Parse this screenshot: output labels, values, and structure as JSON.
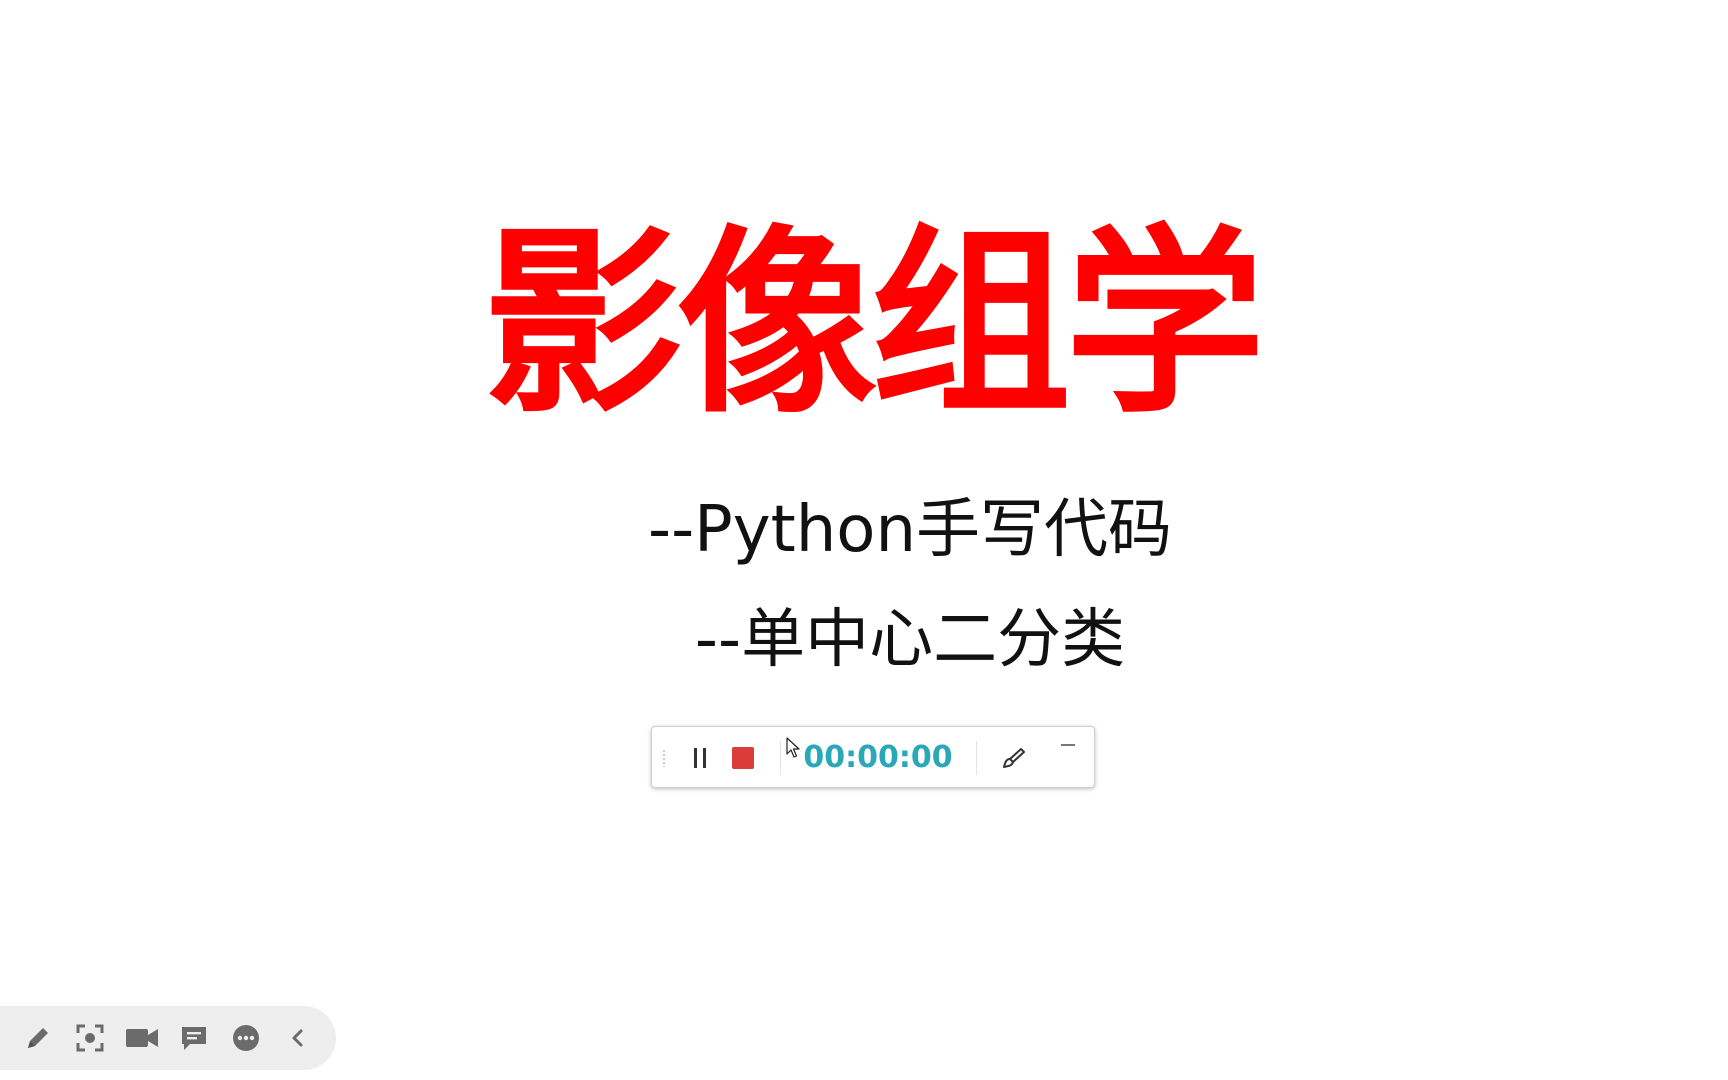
{
  "slide": {
    "title": "影像组学",
    "subtitle_1": "--Python手写代码",
    "subtitle_2": "--单中心二分类"
  },
  "recorder": {
    "timer": "00:00:00",
    "timer_color": "#2aa7b9",
    "stop_color": "#db3b3b",
    "icons": [
      "pause-icon",
      "stop-icon",
      "brush-icon",
      "minimize-icon"
    ]
  },
  "dock": {
    "icons": [
      "pencil-icon",
      "screenshot-icon",
      "video-camera-icon",
      "comment-icon",
      "more-icon",
      "chevron-left-icon"
    ]
  },
  "colors": {
    "title": "#fe0000",
    "subtitle": "#111111",
    "background": "#ffffff"
  }
}
